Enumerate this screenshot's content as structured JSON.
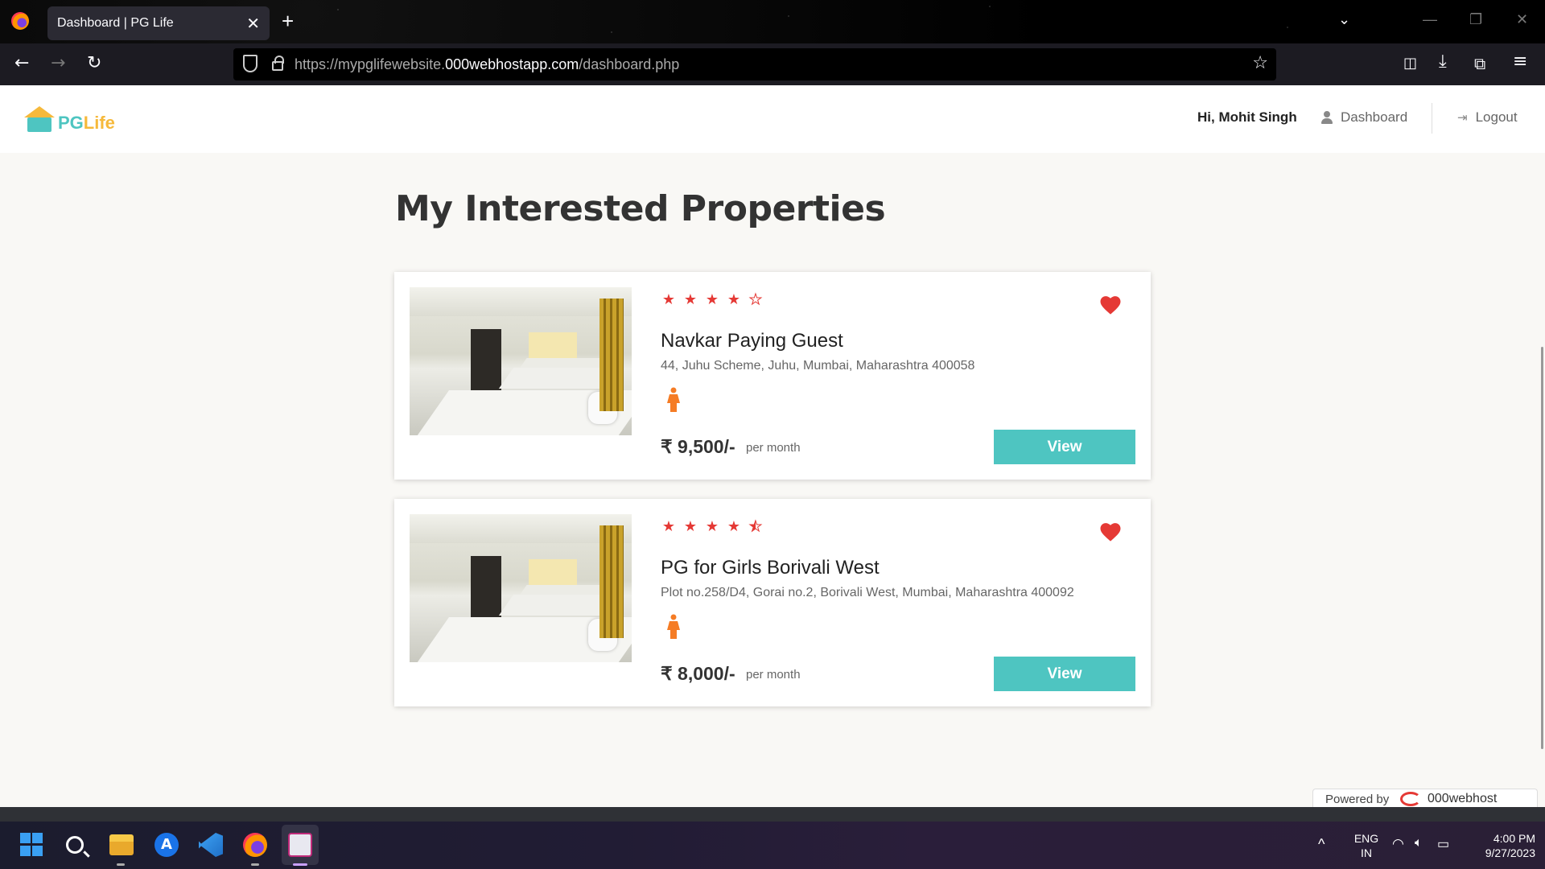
{
  "browser": {
    "tab_title": "Dashboard | PG Life",
    "tab_close": "✕",
    "new_tab": "+",
    "url_prefix": "https://mypglifewebsite.",
    "url_domain": "000webhostapp.com",
    "url_path": "/dashboard.php"
  },
  "header": {
    "logo_text_main": "PG",
    "logo_text_accent": "Life",
    "greeting": "Hi, Mohit Singh",
    "dashboard_label": "Dashboard",
    "logout_label": "Logout"
  },
  "page_title": "My Interested Properties",
  "properties": [
    {
      "name": "Navkar Paying Guest",
      "address": "44, Juhu Scheme, Juhu, Mumbai, Maharashtra 400058",
      "rating": 4,
      "price": "₹ 9,500/-",
      "per": "per month",
      "button": "View",
      "interested": true,
      "gender_icon": "female-icon"
    },
    {
      "name": "PG for Girls Borivali West",
      "address": "Plot no.258/D4, Gorai no.2, Borivali West, Mumbai, Maharashtra 400092",
      "rating": 4.5,
      "price": "₹ 8,000/-",
      "per": "per month",
      "button": "View",
      "interested": true,
      "gender_icon": "female-icon"
    }
  ],
  "powered_by": {
    "label": "Powered by",
    "brand": "000webhost"
  },
  "taskbar": {
    "lang_top": "ENG",
    "lang_bottom": "IN",
    "time": "4:00 PM",
    "date": "9/27/2023"
  },
  "colors": {
    "accent": "#4ec5c1",
    "logo_yellow": "#f6b93b",
    "star_red": "#e53935",
    "heart_red": "#e53935",
    "gender_orange": "#f57c25"
  }
}
